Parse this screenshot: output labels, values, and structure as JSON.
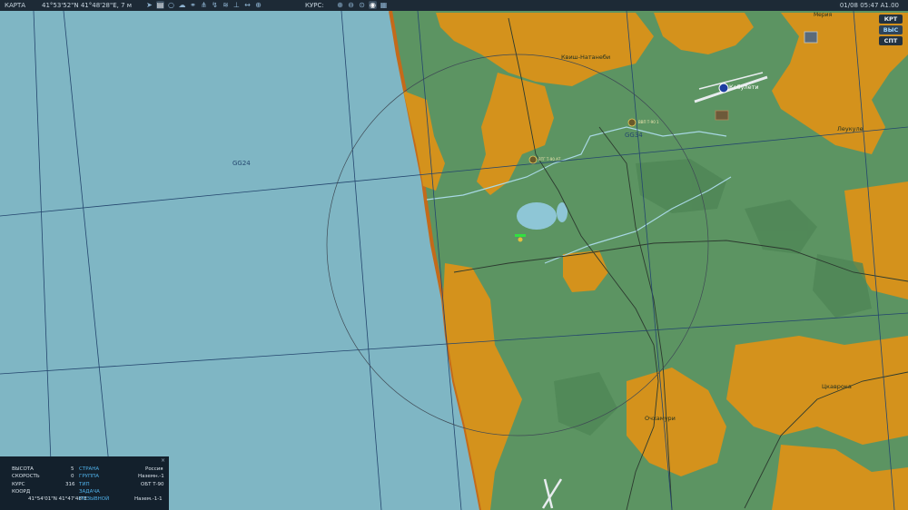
{
  "topbar": {
    "title": "КАРТА",
    "coordinates": "41°53'52\"N 41°48'28\"E, 7 м",
    "course_label": "КУРС:",
    "datetime": "01/08 05:47 A1.00"
  },
  "toolbar_icons": [
    "send-icon",
    "layer-icon",
    "circle-icon",
    "cloud-icon",
    "link-icon",
    "network-icon",
    "wifi-icon",
    "tower-icon",
    "arrows-icon",
    "target-icon"
  ],
  "zoom_icons": [
    "zoom-in-icon",
    "zoom-out-icon",
    "zoom-fit-icon",
    "globe-icon",
    "grid-icon"
  ],
  "side_buttons": [
    {
      "label": "КРТ",
      "selected": false
    },
    {
      "label": "ВЫС",
      "selected": true
    },
    {
      "label": "СПТ",
      "selected": false
    }
  ],
  "map": {
    "grid_labels": [
      "GG24",
      "GG34"
    ],
    "places": [
      "Квиш-Натанеби",
      "Кобулети",
      "Мерия",
      "Леукуле",
      "Цкаврока",
      "Очхамури"
    ],
    "unit_labels": [
      "ВТГ Т-90 АТ",
      "ВВП Т-90 1"
    ],
    "colors": {
      "sea": "#7fb6c4",
      "land": "#5c9462",
      "forest": "#d4921c",
      "coast": "#c46a1a"
    }
  },
  "info_panel": {
    "rows": [
      {
        "label": "ВЫСОТА",
        "value": "5",
        "key": "СТРАНА",
        "key_value": "Россия"
      },
      {
        "label": "СКОРОСТЬ",
        "value": "0",
        "key": "ГРУППА",
        "key_value": "Наземн.-1"
      },
      {
        "label": "КУРС",
        "value": "316",
        "key": "ТИП",
        "key_value": "ОБТ Т-90"
      },
      {
        "label": "КООРД",
        "value": "",
        "key": "ЗАДАЧА",
        "key_value": ""
      },
      {
        "label": "",
        "value": "41°54'01\"N 41°47'48\"E",
        "key": "ПОЗЫВНОЙ",
        "key_value": "Назем.-1-1"
      }
    ]
  }
}
